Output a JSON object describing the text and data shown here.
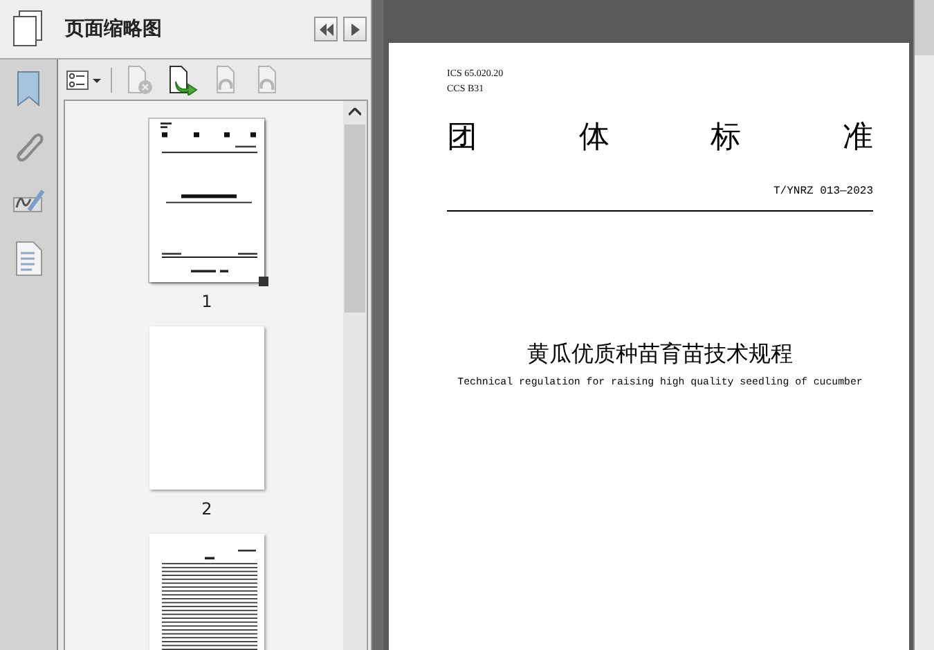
{
  "panel": {
    "title": "页面缩略图"
  },
  "toolbar": [
    {
      "kind": "options",
      "disabled": false
    },
    {
      "kind": "delete",
      "disabled": true
    },
    {
      "kind": "insert",
      "disabled": false
    },
    {
      "kind": "rotate-left",
      "disabled": true
    },
    {
      "kind": "rotate-right",
      "disabled": true
    }
  ],
  "thumbnails": [
    {
      "kind": "cover",
      "label": "1",
      "selected": true
    },
    {
      "kind": "blank",
      "label": "2",
      "selected": false
    },
    {
      "kind": "contents",
      "selected": false
    }
  ],
  "document": {
    "ics": "ICS  65.020.20",
    "ccs": "CCS  B31",
    "heading": [
      "团",
      "体",
      "标",
      "准"
    ],
    "code": "T/YNRZ 013—2023",
    "name": "黄瓜优质种苗育苗技术规程",
    "english_name": "Technical regulation for raising high quality seedling of cucumber"
  }
}
